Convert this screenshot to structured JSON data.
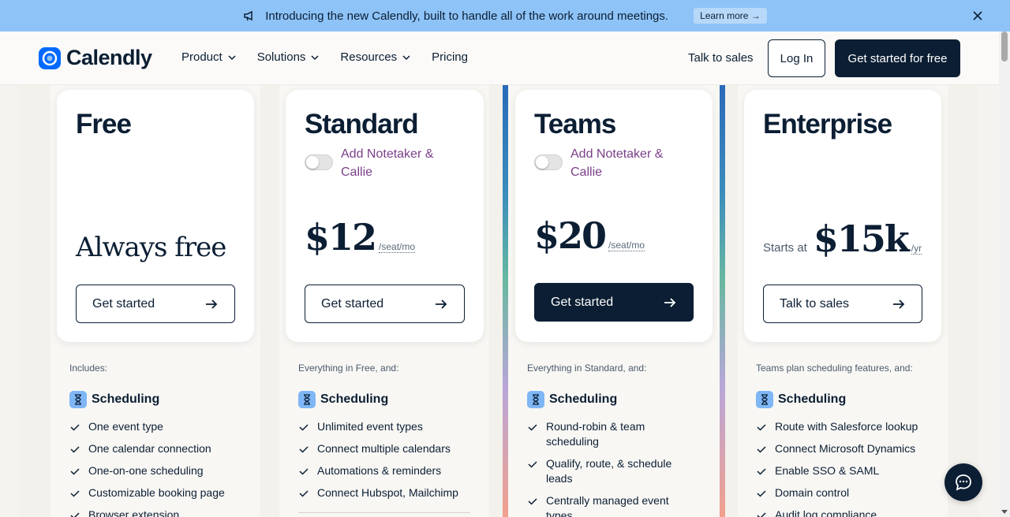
{
  "announcement": {
    "text": "Introducing the new Calendly, built to handle all of the work around meetings.",
    "learn_more": "Learn more →"
  },
  "header": {
    "logo": "Calendly",
    "nav": [
      "Product",
      "Solutions",
      "Resources",
      "Pricing"
    ],
    "talk_to_sales": "Talk to sales",
    "login": "Log In",
    "get_started": "Get started for free"
  },
  "plans": [
    {
      "name": "Free",
      "price_text": "Always free",
      "cta": "Get started",
      "includes": "Includes:",
      "section": "Scheduling",
      "features": [
        "One event type",
        "One calendar connection",
        "One-on-one scheduling",
        "Customizable booking page",
        "Browser extension"
      ]
    },
    {
      "name": "Standard",
      "toggle_label": "Add Notetaker & Callie",
      "price": "$12",
      "unit": "/seat/mo",
      "cta": "Get started",
      "includes": "Everything in Free, and:",
      "section": "Scheduling",
      "features": [
        "Unlimited event types",
        "Connect multiple calendars",
        "Automations & reminders",
        "Connect Hubspot, Mailchimp"
      ]
    },
    {
      "name": "Teams",
      "toggle_label": "Add Notetaker & Callie",
      "price": "$20",
      "unit": "/seat/mo",
      "cta": "Get started",
      "includes": "Everything in Standard, and:",
      "section": "Scheduling",
      "features": [
        "Round-robin & team scheduling",
        "Qualify, route, & schedule leads",
        "Centrally managed event types"
      ]
    },
    {
      "name": "Enterprise",
      "starts_at": "Starts at",
      "price": "$15k",
      "unit": "/yr",
      "cta": "Talk to sales",
      "includes": "Teams plan scheduling features, and:",
      "section": "Scheduling",
      "features": [
        "Route with Salesforce lookup",
        "Connect Microsoft Dynamics",
        "Enable SSO & SAML",
        "Domain control",
        "Audit log compliance"
      ]
    }
  ],
  "colors": {
    "navy": "#0b1e33",
    "announcement_bg": "#8ec3f7",
    "toggle_label": "#7b3f8a",
    "feature_icon": "#7fb6f6"
  },
  "icons": [
    "megaphone-icon",
    "close-icon",
    "chevron-down-icon",
    "arrow-right-icon",
    "check-icon",
    "hourglass-icon",
    "chat-icon"
  ]
}
